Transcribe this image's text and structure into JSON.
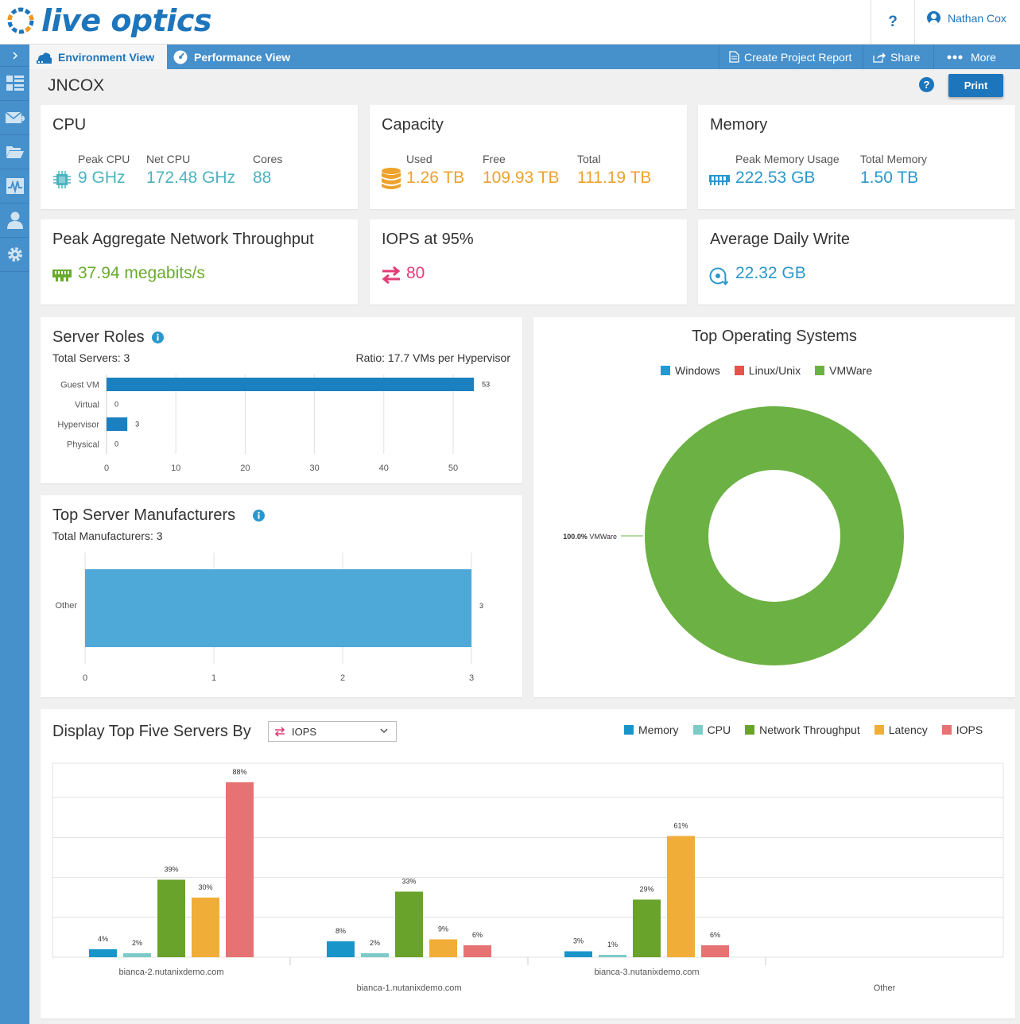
{
  "header": {
    "logo_text": "live optics",
    "help_label": "?",
    "user_name": "Nathan Cox"
  },
  "tabs": [
    {
      "label": "Environment View",
      "icon": "environment-icon",
      "active": true
    },
    {
      "label": "Performance View",
      "icon": "gauge-icon",
      "active": false
    }
  ],
  "toolbar": {
    "create_report": "Create Project Report",
    "share": "Share",
    "more": "More"
  },
  "sidebar": {
    "items": [
      "dashboard-icon",
      "mail-icon",
      "folder-icon",
      "pulse-icon",
      "user-icon",
      "gear-icon"
    ]
  },
  "page": {
    "title": "JNCOX",
    "help": "?",
    "print": "Print"
  },
  "cpu": {
    "title": "CPU",
    "peak_label": "Peak CPU",
    "peak": "9 GHz",
    "net_label": "Net CPU",
    "net": "172.48 GHz",
    "cores_label": "Cores",
    "cores": "88"
  },
  "capacity": {
    "title": "Capacity",
    "used_label": "Used",
    "used": "1.26 TB",
    "free_label": "Free",
    "free": "109.93 TB",
    "total_label": "Total",
    "total": "111.19 TB"
  },
  "memory": {
    "title": "Memory",
    "peak_label": "Peak Memory Usage",
    "peak": "222.53 GB",
    "total_label": "Total Memory",
    "total": "1.50 TB"
  },
  "network": {
    "title": "Peak Aggregate Network Throughput",
    "value": "37.94 megabits/s"
  },
  "iops": {
    "title": "IOPS at 95%",
    "value": "80"
  },
  "daily_write": {
    "title": "Average Daily Write",
    "value": "22.32 GB"
  },
  "server_roles": {
    "title": "Server Roles",
    "total": "Total Servers: 3",
    "ratio": "Ratio: 17.7 VMs per Hypervisor"
  },
  "manufacturers": {
    "title": "Top Server Manufacturers",
    "total": "Total Manufacturers: 3"
  },
  "top_os": {
    "title": "Top Operating Systems",
    "slice_label_pct": "100.0%",
    "slice_label_name": "VMWare"
  },
  "top_five": {
    "title": "Display Top Five Servers By",
    "selected": "IOPS",
    "legend": [
      {
        "name": "Memory",
        "color": "#1a95c9"
      },
      {
        "name": "CPU",
        "color": "#7dcbc8"
      },
      {
        "name": "Network Throughput",
        "color": "#6aa32b"
      },
      {
        "name": "Latency",
        "color": "#f0ad37"
      },
      {
        "name": "IOPS",
        "color": "#e77273"
      }
    ]
  },
  "chart_data": [
    {
      "type": "bar",
      "orientation": "horizontal",
      "categories": [
        "Guest VM",
        "Virtual",
        "Hypervisor",
        "Physical"
      ],
      "values": [
        53,
        0,
        3,
        0
      ],
      "xlim": [
        0,
        55
      ],
      "xticks": [
        0,
        10,
        20,
        30,
        40,
        50
      ],
      "color": "#1b80c0",
      "grid": true
    },
    {
      "type": "bar",
      "orientation": "horizontal",
      "categories": [
        "Other"
      ],
      "values": [
        3
      ],
      "xlim": [
        0,
        3
      ],
      "xticks": [
        0,
        1,
        2,
        3
      ],
      "color": "#4fa9d8",
      "grid": true
    },
    {
      "type": "pie",
      "donut": true,
      "legend": [
        "Windows",
        "Linux/Unix",
        "VMWare"
      ],
      "colors": [
        "#1e9bd7",
        "#e6534c",
        "#6cb144"
      ],
      "values": [
        0,
        0,
        100
      ],
      "legend_position": "top"
    },
    {
      "type": "bar",
      "categories": [
        "bianca-2.nutanixdemo.com",
        "bianca-1.nutanixdemo.com",
        "bianca-3.nutanixdemo.com",
        "Other"
      ],
      "series": [
        {
          "name": "Memory",
          "values": [
            4,
            8,
            3,
            null
          ]
        },
        {
          "name": "CPU",
          "values": [
            2,
            2,
            1,
            null
          ]
        },
        {
          "name": "Network Throughput",
          "values": [
            39,
            33,
            29,
            null
          ]
        },
        {
          "name": "Latency",
          "values": [
            30,
            9,
            61,
            null
          ]
        },
        {
          "name": "IOPS",
          "values": [
            88,
            6,
            6,
            null
          ]
        }
      ],
      "ylim": [
        0,
        100
      ],
      "grid": true,
      "legend_position": "top-right"
    }
  ]
}
